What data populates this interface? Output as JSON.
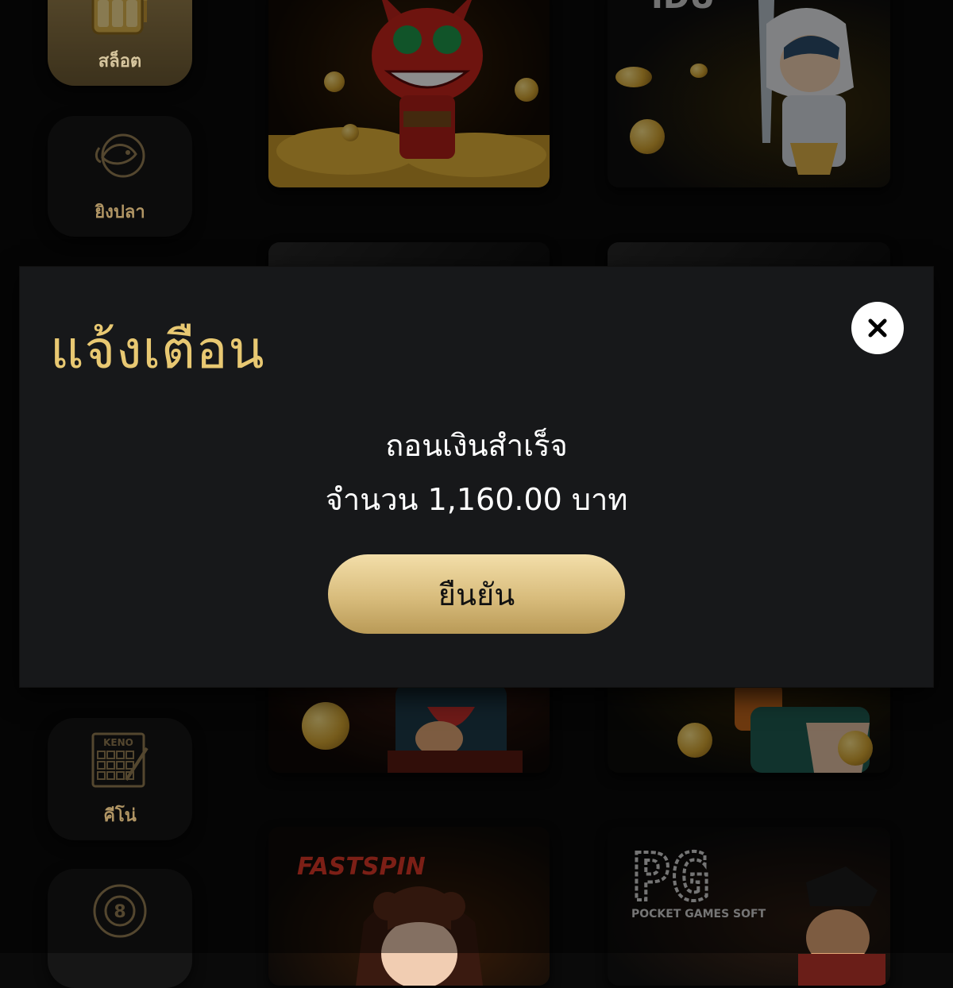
{
  "sidebar": {
    "items": [
      {
        "label": "สล็อต",
        "icon": "slot-machine-icon"
      },
      {
        "label": "ยิงปลา",
        "icon": "fish-shooting-icon"
      },
      {
        "label": "คีโน่",
        "icon": "keno-icon",
        "icon_text": "KENO"
      },
      {
        "label": "",
        "icon": "eight-ball-icon",
        "icon_text": "8"
      }
    ]
  },
  "game_cards": [
    {
      "name": "red-demon-slot"
    },
    {
      "name": "hooded-knight-slot",
      "logo_text": "IDU"
    },
    {
      "name": "pirate-slot-left"
    },
    {
      "name": "pumpkin-slot-right"
    },
    {
      "name": "fastspin-provider",
      "logo_text": "FASTSPIN"
    },
    {
      "name": "pg-provider",
      "logo_text": "PG",
      "logo_subtext": "POCKET GAMES SOFT"
    }
  ],
  "modal": {
    "title": "แจ้งเตือน",
    "message_line1": "ถอนเงินสำเร็จ",
    "message_line2": "จำนวน 1,160.00 บาท",
    "confirm_label": "ยืนยัน",
    "close_icon": "close-icon"
  },
  "colors": {
    "accent_gold": "#e8c872",
    "modal_bg": "#17181a",
    "page_bg": "#0a0a0a"
  }
}
